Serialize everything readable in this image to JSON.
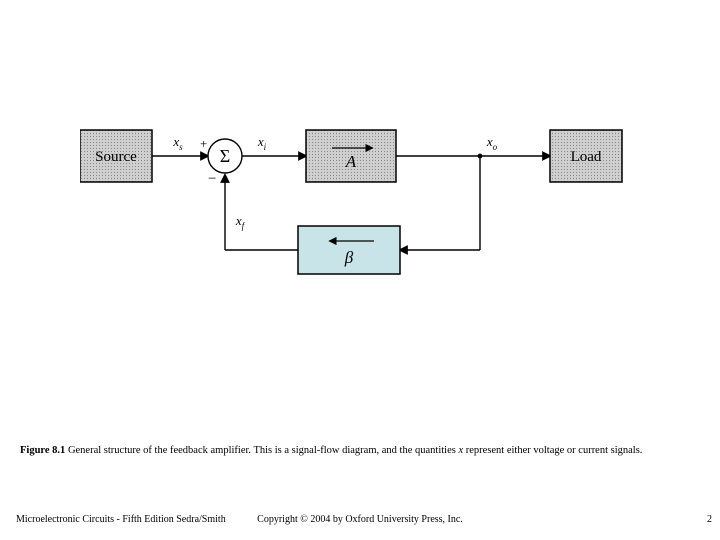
{
  "diagram": {
    "blocks": {
      "source": "Source",
      "summation": "Σ",
      "amplifier": "A",
      "feedback": "β",
      "load": "Load"
    },
    "signals": {
      "xs": "x",
      "xs_sub": "s",
      "xi": "x",
      "xi_sub": "i",
      "xo": "x",
      "xo_sub": "o",
      "xf": "x",
      "xf_sub": "f"
    },
    "sum_plus": "+",
    "sum_minus": "−"
  },
  "caption": {
    "fig_label": "Figure 8.1",
    "text_a": "  General structure of the feedback amplifier. This is a signal-flow diagram, and the quantities ",
    "var": "x",
    "text_b": " represent either voltage or current signals."
  },
  "footer": {
    "left": "Microelectronic Circuits - Fifth Edition    Sedra/Smith",
    "center": "Copyright © 2004 by Oxford University Press, Inc.",
    "right": "2"
  }
}
